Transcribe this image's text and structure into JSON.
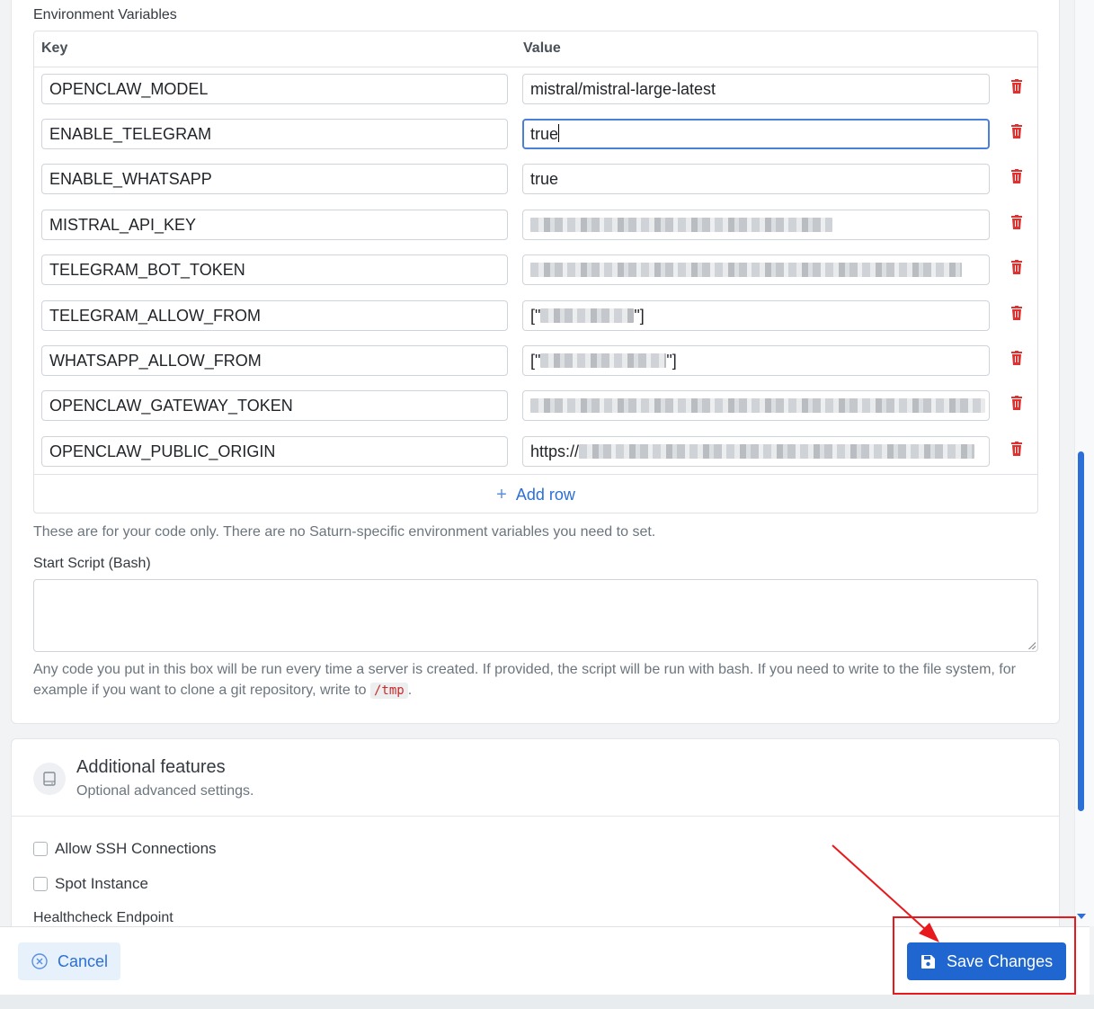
{
  "env_section": {
    "title": "Environment Variables",
    "col_key": "Key",
    "col_value": "Value",
    "rows": [
      {
        "key": "OPENCLAW_MODEL",
        "value": "mistral/mistral-large-latest"
      },
      {
        "key": "ENABLE_TELEGRAM",
        "value": "true"
      },
      {
        "key": "ENABLE_WHATSAPP",
        "value": "true"
      },
      {
        "key": "MISTRAL_API_KEY",
        "value": ""
      },
      {
        "key": "TELEGRAM_BOT_TOKEN",
        "value": ""
      },
      {
        "key": "TELEGRAM_ALLOW_FROM",
        "value_prefix": "[\"",
        "value_suffix": "\"]"
      },
      {
        "key": "WHATSAPP_ALLOW_FROM",
        "value_prefix": "[\"",
        "value_suffix": "\"]"
      },
      {
        "key": "OPENCLAW_GATEWAY_TOKEN",
        "value": ""
      },
      {
        "key": "OPENCLAW_PUBLIC_ORIGIN",
        "value_prefix": "https://"
      }
    ],
    "add_row_label": "Add row",
    "help_text": "These are for your code only. There are no Saturn-specific environment variables you need to set."
  },
  "start_script": {
    "label": "Start Script (Bash)",
    "value": "",
    "help_before": "Any code you put in this box will be run every time a server is created. If provided, the script will be run with bash. If you need to write to the file system, for example if you want to clone a git repository, write to",
    "help_code": "/tmp",
    "help_after": "."
  },
  "additional_features": {
    "title": "Additional features",
    "subtitle": "Optional advanced settings.",
    "icon": "hard-drive-icon",
    "checkboxes": [
      {
        "label": "Allow SSH Connections",
        "checked": false
      },
      {
        "label": "Spot Instance",
        "checked": false
      }
    ],
    "healthcheck_label": "Healthcheck Endpoint"
  },
  "footer": {
    "cancel_label": "Cancel",
    "save_label": "Save Changes"
  },
  "colors": {
    "accent": "#1f66d1",
    "delete": "#e03131",
    "annotation": "#e8191c"
  }
}
